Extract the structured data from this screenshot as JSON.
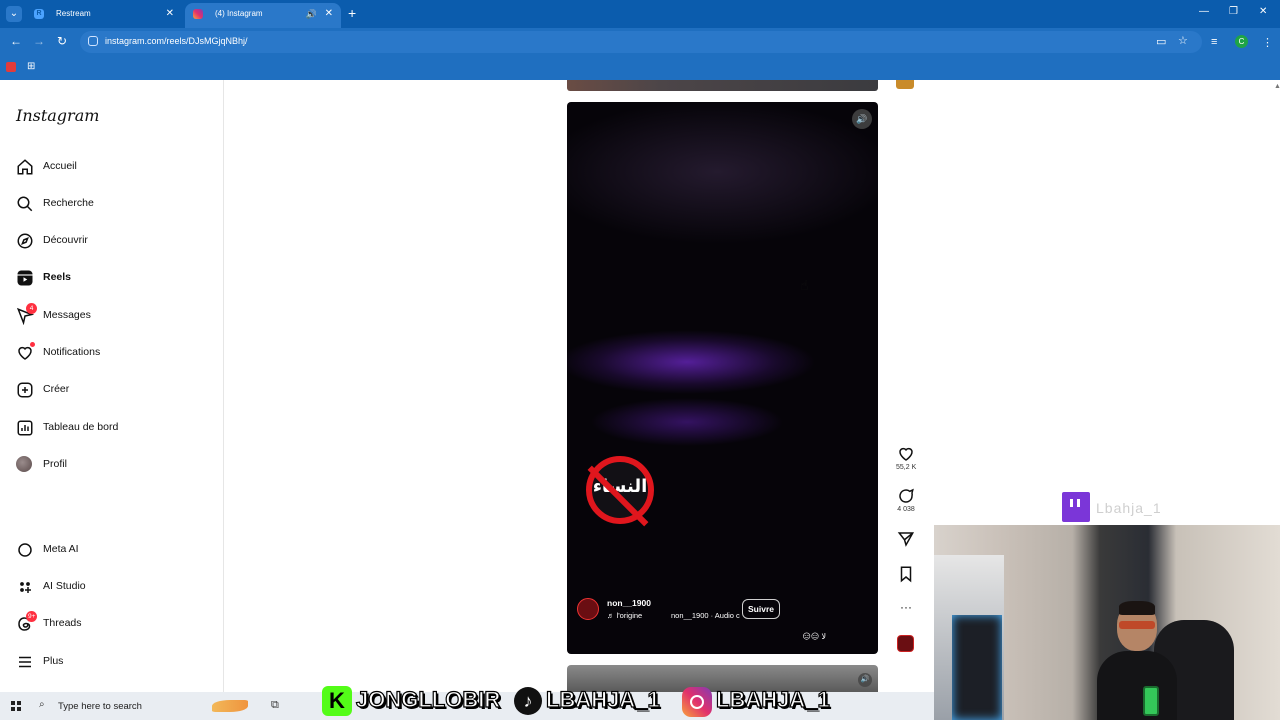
{
  "browser": {
    "tabs": [
      {
        "title": "Restream",
        "active": false
      },
      {
        "title": "(4) Instagram",
        "active": true
      }
    ],
    "url": "instagram.com/reels/DJsMGjqNBhj/",
    "new_tab": "+",
    "profile_initial": "C"
  },
  "sidebar": {
    "logo": "Instagram",
    "items": [
      {
        "label": "Accueil",
        "icon": "home-icon"
      },
      {
        "label": "Recherche",
        "icon": "search-icon"
      },
      {
        "label": "Découvrir",
        "icon": "compass-icon"
      },
      {
        "label": "Reels",
        "icon": "reels-icon",
        "active": true
      },
      {
        "label": "Messages",
        "icon": "messenger-icon",
        "badge": "4"
      },
      {
        "label": "Notifications",
        "icon": "heart-icon",
        "dot": true
      },
      {
        "label": "Créer",
        "icon": "plus-square-icon"
      },
      {
        "label": "Tableau de bord",
        "icon": "dashboard-icon"
      },
      {
        "label": "Profil",
        "icon": "avatar"
      }
    ],
    "bottom_items": [
      {
        "label": "Meta AI",
        "icon": "meta-ai-icon"
      },
      {
        "label": "AI Studio",
        "icon": "ai-studio-icon"
      },
      {
        "label": "Threads",
        "icon": "threads-icon",
        "badge": "9+"
      },
      {
        "label": "Plus",
        "icon": "menu-icon"
      }
    ]
  },
  "reel": {
    "username": "non__1900",
    "audio_label": "♬ l'origine",
    "audio_detail": "non__1900 · Audio c",
    "follow_label": "Suivre",
    "caption": "😑😑 لا",
    "overlay_text": "النساء",
    "likes": "55,2 K",
    "comments": "4 038"
  },
  "stream": {
    "banner_kick": "JONGLLOBIR",
    "banner_tiktok": "LBAHJA_1",
    "banner_instagram": "LBAHJA_1",
    "kick_letter": "K",
    "twitch_name": "Lbahja_1"
  },
  "taskbar": {
    "search_placeholder": "Type here to search"
  },
  "colors": {
    "browser_blue": "#1f6fc0",
    "instagram_red": "#ff3040",
    "twitch_purple": "#7b36d8",
    "kick_green": "#53fc18"
  }
}
